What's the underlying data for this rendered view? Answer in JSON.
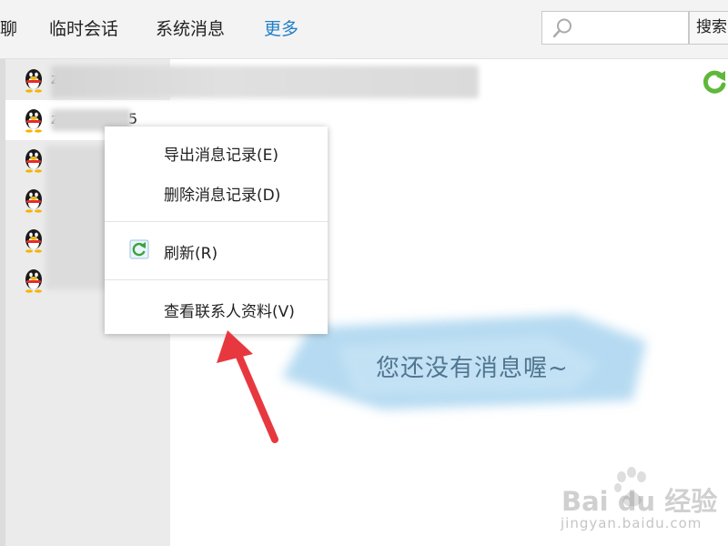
{
  "tabs": [
    {
      "label": "聊",
      "active": false
    },
    {
      "label": "临时会话",
      "active": false
    },
    {
      "label": "系统消息",
      "active": false
    },
    {
      "label": "更多",
      "active": true
    }
  ],
  "search": {
    "placeholder": "",
    "value": "",
    "button_label": "搜索"
  },
  "contacts": [
    {
      "name": "z",
      "icon": "qq-penguin-icon",
      "selected": false
    },
    {
      "name": "z",
      "name_end": "5",
      "icon": "qq-penguin-icon",
      "selected": true
    },
    {
      "name": "",
      "icon": "qq-penguin-icon",
      "selected": false
    },
    {
      "name": "",
      "icon": "qq-penguin-icon",
      "selected": false
    },
    {
      "name": "",
      "icon": "qq-penguin-icon",
      "selected": false
    },
    {
      "name": "",
      "icon": "qq-penguin-icon",
      "selected": false
    }
  ],
  "context_menu": {
    "items": [
      {
        "label": "导出消息记录(E)",
        "icon": null
      },
      {
        "label": "删除消息记录(D)",
        "icon": null
      },
      {
        "label": "刷新(R)",
        "icon": "refresh-icon"
      },
      {
        "label": "查看联系人资料(V)",
        "icon": null
      }
    ]
  },
  "empty_state": {
    "text": "您还没有消息喔~"
  },
  "watermark": {
    "brand": "Bai du 经验",
    "url": "jingyan.baidu.com"
  },
  "colors": {
    "accent": "#1f7fc9",
    "arrow": "#e8383f",
    "refresh_green": "#5fb83a"
  }
}
